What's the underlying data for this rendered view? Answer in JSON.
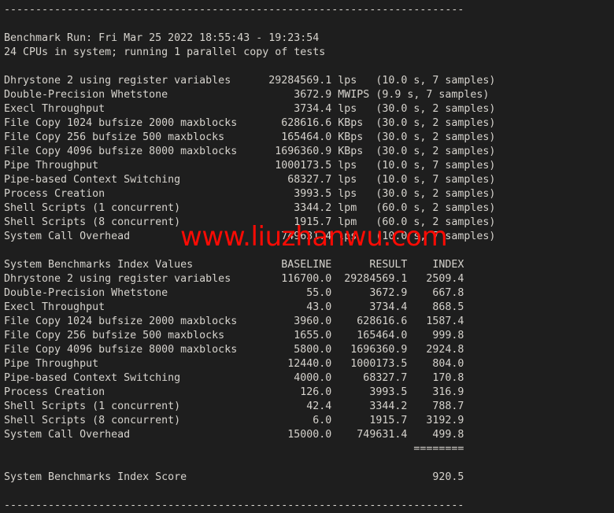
{
  "terminal": {
    "separator_top": "-------------------------------------------------------------------------",
    "separator_bottom": "-------------------------------------------------------------------------",
    "header_lines": [
      "Benchmark Run: Fri Mar 25 2022 18:55:43 - 19:23:54",
      "24 CPUs in system; running 1 parallel copy of tests"
    ],
    "results": [
      {
        "name": "Dhrystone 2 using register variables",
        "value": "29284569.1",
        "unit": "lps",
        "detail": "(10.0 s, 7 samples)"
      },
      {
        "name": "Double-Precision Whetstone",
        "value": "3672.9",
        "unit": "MWIPS",
        "detail": "(9.9 s, 7 samples)"
      },
      {
        "name": "Execl Throughput",
        "value": "3734.4",
        "unit": "lps",
        "detail": "(30.0 s, 2 samples)"
      },
      {
        "name": "File Copy 1024 bufsize 2000 maxblocks",
        "value": "628616.6",
        "unit": "KBps",
        "detail": "(30.0 s, 2 samples)"
      },
      {
        "name": "File Copy 256 bufsize 500 maxblocks",
        "value": "165464.0",
        "unit": "KBps",
        "detail": "(30.0 s, 2 samples)"
      },
      {
        "name": "File Copy 4096 bufsize 8000 maxblocks",
        "value": "1696360.9",
        "unit": "KBps",
        "detail": "(30.0 s, 2 samples)"
      },
      {
        "name": "Pipe Throughput",
        "value": "1000173.5",
        "unit": "lps",
        "detail": "(10.0 s, 7 samples)"
      },
      {
        "name": "Pipe-based Context Switching",
        "value": "68327.7",
        "unit": "lps",
        "detail": "(10.0 s, 7 samples)"
      },
      {
        "name": "Process Creation",
        "value": "3993.5",
        "unit": "lps",
        "detail": "(30.0 s, 2 samples)"
      },
      {
        "name": "Shell Scripts (1 concurrent)",
        "value": "3344.2",
        "unit": "lpm",
        "detail": "(60.0 s, 2 samples)"
      },
      {
        "name": "Shell Scripts (8 concurrent)",
        "value": "1915.7",
        "unit": "lpm",
        "detail": "(60.0 s, 2 samples)"
      },
      {
        "name": "System Call Overhead",
        "value": "749631.4",
        "unit": "lps",
        "detail": "(10.0 s, 7 samples)"
      }
    ],
    "index_table": {
      "title": "System Benchmarks Index Values",
      "columns": [
        "BASELINE",
        "RESULT",
        "INDEX"
      ],
      "rows": [
        {
          "name": "Dhrystone 2 using register variables",
          "baseline": "116700.0",
          "result": "29284569.1",
          "index": "2509.4"
        },
        {
          "name": "Double-Precision Whetstone",
          "baseline": "55.0",
          "result": "3672.9",
          "index": "667.8"
        },
        {
          "name": "Execl Throughput",
          "baseline": "43.0",
          "result": "3734.4",
          "index": "868.5"
        },
        {
          "name": "File Copy 1024 bufsize 2000 maxblocks",
          "baseline": "3960.0",
          "result": "628616.6",
          "index": "1587.4"
        },
        {
          "name": "File Copy 256 bufsize 500 maxblocks",
          "baseline": "1655.0",
          "result": "165464.0",
          "index": "999.8"
        },
        {
          "name": "File Copy 4096 bufsize 8000 maxblocks",
          "baseline": "5800.0",
          "result": "1696360.9",
          "index": "2924.8"
        },
        {
          "name": "Pipe Throughput",
          "baseline": "12440.0",
          "result": "1000173.5",
          "index": "804.0"
        },
        {
          "name": "Pipe-based Context Switching",
          "baseline": "4000.0",
          "result": "68327.7",
          "index": "170.8"
        },
        {
          "name": "Process Creation",
          "baseline": "126.0",
          "result": "3993.5",
          "index": "316.9"
        },
        {
          "name": "Shell Scripts (1 concurrent)",
          "baseline": "42.4",
          "result": "3344.2",
          "index": "788.7"
        },
        {
          "name": "Shell Scripts (8 concurrent)",
          "baseline": "6.0",
          "result": "1915.7",
          "index": "3192.9"
        },
        {
          "name": "System Call Overhead",
          "baseline": "15000.0",
          "result": "749631.4",
          "index": "499.8"
        }
      ],
      "score_rule": "========",
      "score_label": "System Benchmarks Index Score",
      "score_value": "920.5"
    }
  },
  "watermark": {
    "text": "www.liuzhanwu.com",
    "color": "#fb0b04"
  },
  "colors": {
    "background": "#1e1e1e",
    "foreground": "#d6d3cd",
    "watermark": "#fb0b04"
  }
}
